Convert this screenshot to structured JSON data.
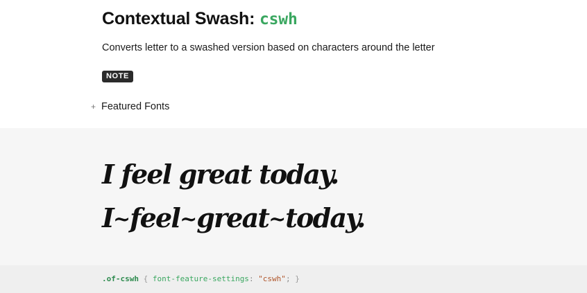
{
  "header": {
    "title": "Contextual Swash:",
    "feature_code": "cswh",
    "description": "Converts letter to a swashed version based on characters around the letter",
    "badge": "NOTE"
  },
  "featured": {
    "toggle_symbol": "+",
    "label": "Featured Fonts"
  },
  "demo": {
    "line_plain": "I feel great today.",
    "line_swash_parts": [
      "I",
      "feel",
      "great",
      "today."
    ],
    "swash_tail": "~"
  },
  "code": {
    "selector": ".of-cswh",
    "open_brace": "{",
    "property": "font-feature-settings",
    "colon": ":",
    "value": "\"cswh\"",
    "semicolon": ";",
    "close_brace": "}"
  },
  "colors": {
    "accent_green": "#3aa760",
    "badge_bg": "#2b2b2b",
    "demo_bg": "#f6f6f6",
    "code_bg": "#efefef",
    "string_color": "#b0562b"
  }
}
